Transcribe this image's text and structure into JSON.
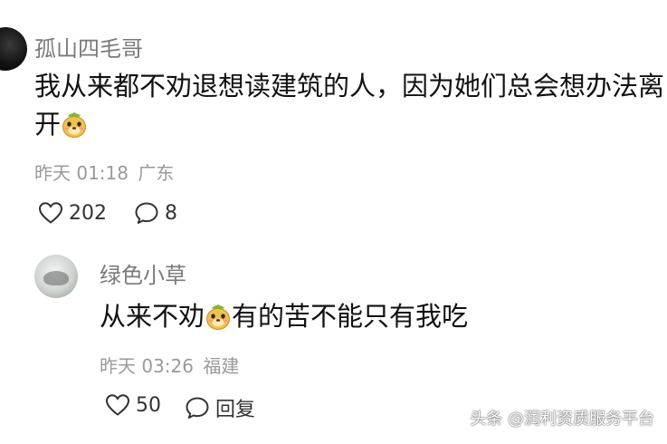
{
  "top_comment": {
    "username": "孤山四毛哥",
    "text_line1": "我从来都不劝退想读建筑的人，因为她们总会想办法离",
    "text_line2": "开",
    "emoji_icon": "doge-face-icon",
    "time": "昨天 01:18",
    "location": "广东",
    "likes": "202",
    "replies": "8"
  },
  "reply": {
    "username": "绿色小草",
    "text_before_emoji": "从来不劝",
    "emoji_icon": "doge-face-icon",
    "text_after_emoji": "有的苦不能只有我吃",
    "time": "昨天 03:26",
    "location": "福建",
    "likes": "50",
    "reply_label": "回复"
  },
  "watermark": "头条 @润利资质服务平台",
  "colors": {
    "username": "#7a7a7a",
    "meta": "#9a9a9a",
    "text": "#111111"
  }
}
